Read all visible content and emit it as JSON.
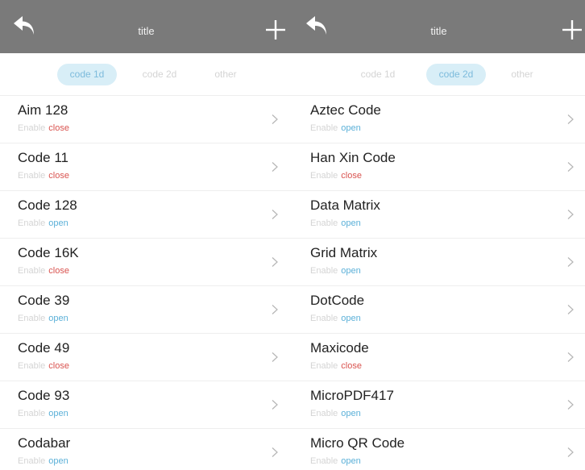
{
  "panels": [
    {
      "header": {
        "title": "title"
      },
      "tabs": [
        {
          "label": "code 1d",
          "active": true
        },
        {
          "label": "code 2d",
          "active": false
        },
        {
          "label": "other",
          "active": false
        }
      ],
      "items": [
        {
          "name": "Aim 128",
          "status_label": "Enable",
          "status": "close"
        },
        {
          "name": "Code 11",
          "status_label": "Enable",
          "status": "close"
        },
        {
          "name": "Code 128",
          "status_label": "Enable",
          "status": "open"
        },
        {
          "name": "Code 16K",
          "status_label": "Enable",
          "status": "close"
        },
        {
          "name": "Code 39",
          "status_label": "Enable",
          "status": "open"
        },
        {
          "name": "Code 49",
          "status_label": "Enable",
          "status": "close"
        },
        {
          "name": "Code 93",
          "status_label": "Enable",
          "status": "open"
        },
        {
          "name": "Codabar",
          "status_label": "Enable",
          "status": "open"
        }
      ]
    },
    {
      "header": {
        "title": "title"
      },
      "tabs": [
        {
          "label": "code 1d",
          "active": false
        },
        {
          "label": "code 2d",
          "active": true
        },
        {
          "label": "other",
          "active": false
        }
      ],
      "items": [
        {
          "name": "Aztec Code",
          "status_label": "Enable",
          "status": "open"
        },
        {
          "name": "Han Xin Code",
          "status_label": "Enable",
          "status": "close"
        },
        {
          "name": "Data Matrix",
          "status_label": "Enable",
          "status": "open"
        },
        {
          "name": "Grid Matrix",
          "status_label": "Enable",
          "status": "open"
        },
        {
          "name": "DotCode",
          "status_label": "Enable",
          "status": "open"
        },
        {
          "name": "Maxicode",
          "status_label": "Enable",
          "status": "close"
        },
        {
          "name": "MicroPDF417",
          "status_label": "Enable",
          "status": "open"
        },
        {
          "name": "Micro QR Code",
          "status_label": "Enable",
          "status": "open"
        }
      ]
    }
  ],
  "colors": {
    "header_bg": "#7a7a7a",
    "tab_active_bg": "#d8eef7",
    "tab_active_text": "#7dbbdc",
    "status_close": "#d9534f",
    "status_open": "#5bb0d8"
  },
  "icons": {
    "back": "back-arrow-icon",
    "add": "plus-icon",
    "row": "chevron-right-icon"
  }
}
